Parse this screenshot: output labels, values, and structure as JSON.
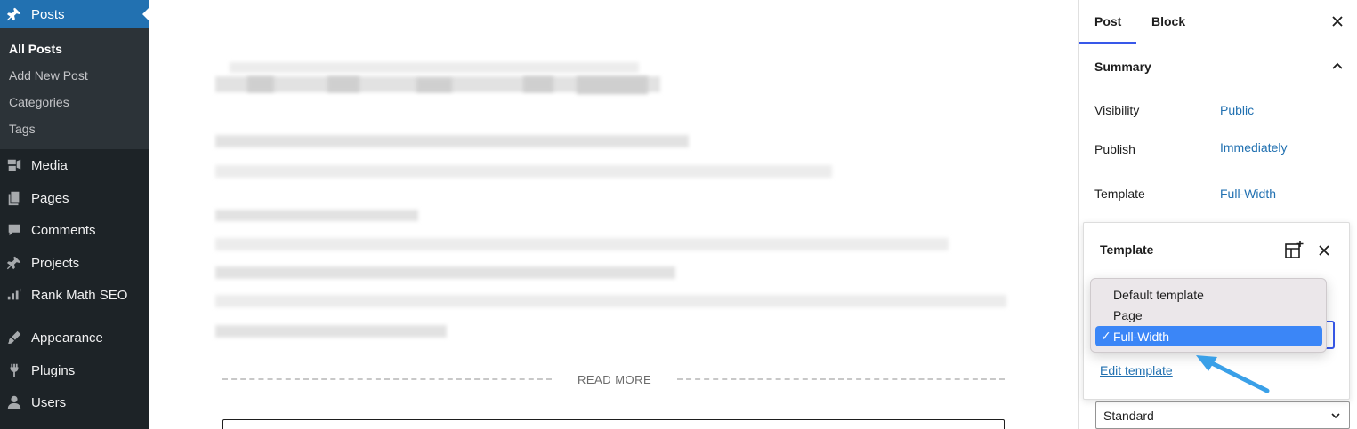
{
  "sidebar": {
    "items": [
      {
        "label": "Posts",
        "icon": "pin-icon"
      },
      {
        "label": "Media",
        "icon": "media-icon"
      },
      {
        "label": "Pages",
        "icon": "pages-icon"
      },
      {
        "label": "Comments",
        "icon": "comment-icon"
      },
      {
        "label": "Projects",
        "icon": "pin-icon"
      },
      {
        "label": "Rank Math SEO",
        "icon": "chart-icon"
      },
      {
        "label": "Appearance",
        "icon": "brush-icon"
      },
      {
        "label": "Plugins",
        "icon": "plug-icon"
      },
      {
        "label": "Users",
        "icon": "user-icon"
      }
    ],
    "submenu": [
      "All Posts",
      "Add New Post",
      "Categories",
      "Tags"
    ]
  },
  "editor": {
    "more_label": "READ MORE"
  },
  "panel": {
    "tabs": [
      "Post",
      "Block"
    ],
    "summary_title": "Summary",
    "rows": [
      {
        "label": "Visibility",
        "value": "Public"
      },
      {
        "label": "Publish",
        "value": "Immediately"
      },
      {
        "label": "Template",
        "value": "Full-Width"
      }
    ],
    "popover": {
      "title": "Template",
      "options": [
        "Default template",
        "Page",
        "Full-Width"
      ],
      "selected": "Full-Width",
      "check": "✓",
      "edit_link": "Edit template"
    },
    "format_value": "Standard"
  },
  "colors": {
    "sidebar_bg": "#1d2327",
    "active_menu": "#2271b1",
    "link": "#2271b1",
    "tab_accent": "#3858e9",
    "annotation_arrow": "#3aa0e8"
  }
}
